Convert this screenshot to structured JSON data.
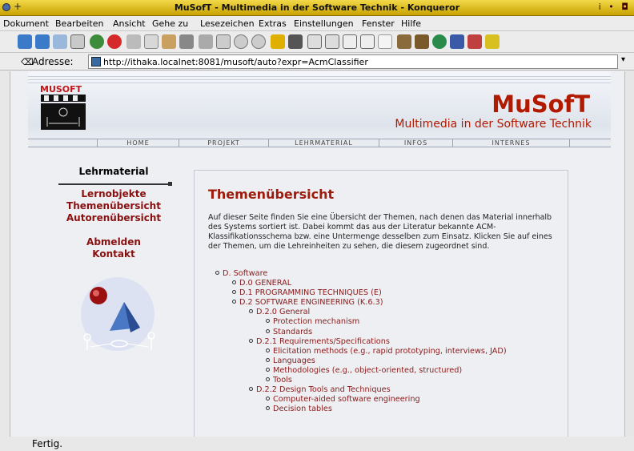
{
  "window": {
    "title": "MuSofT - Multimedia in der Software Technik - Konqueror",
    "controls": "i • ◘"
  },
  "menu": [
    "Dokument",
    "Bearbeiten",
    "Ansicht",
    "Gehe zu",
    "Lesezeichen",
    "Extras",
    "Einstellungen",
    "Fenster",
    "Hilfe"
  ],
  "location": {
    "label": "Adresse:",
    "url": "http://ithaka.localnet:8081/musoft/auto?expr=AcmClassifier"
  },
  "status": "Fertig.",
  "page": {
    "logo_text": "MUSOFT",
    "brand": "MuSofT",
    "tagline": "Multimedia in der Software Technik",
    "nav": [
      "HOME",
      "PROJEKT",
      "LEHRMATERIAL",
      "INFOS",
      "INTERNES"
    ],
    "sidebar": {
      "heading": "Lehrmaterial",
      "links1": [
        "Lernobjekte",
        "Themenübersicht",
        "Autorenübersicht"
      ],
      "links2": [
        "Abmelden",
        "Kontakt"
      ]
    },
    "content": {
      "title": "Themenübersicht",
      "intro": "Auf dieser Seite finden Sie eine Übersicht der Themen, nach denen das Material innerhalb des Systems sortiert ist. Dabei kommt das aus der Literatur bekannte ACM-Klassifikationsschema bzw. eine Untermenge desselben zum Einsatz. Klicken Sie auf eines der Themen, um die Lehreinheiten zu sehen, die diesem zugeordnet sind.",
      "tree": {
        "root": "D. Software",
        "d0": "D.0 GENERAL",
        "d1": "D.1 PROGRAMMING TECHNIQUES (E)",
        "d2": "D.2 SOFTWARE ENGINEERING (K.6.3)",
        "d20": "D.2.0 General",
        "d20_items": [
          "Protection mechanism",
          "Standards"
        ],
        "d21": "D.2.1 Requirements/Specifications",
        "d21_items": [
          "Elicitation methods (e.g., rapid prototyping, interviews, JAD)",
          "Languages",
          "Methodologies (e.g., object-oriented, structured)",
          "Tools"
        ],
        "d22": "D.2.2 Design Tools and Techniques",
        "d22_items": [
          "Computer-aided software engineering",
          "Decision tables"
        ]
      }
    }
  }
}
